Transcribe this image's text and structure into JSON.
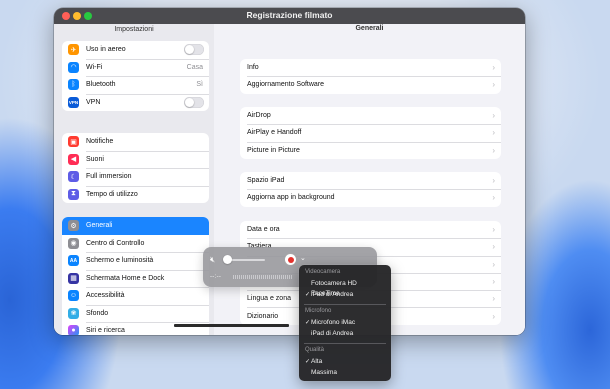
{
  "window": {
    "title": "Registrazione filmato",
    "sidebar_title": "Impostazioni",
    "main_title": "Generali"
  },
  "sidebar": {
    "group1": [
      {
        "label": "Uso in aereo",
        "icon": "airplane-icon",
        "color": "#ff9500",
        "control": "toggle"
      },
      {
        "label": "Wi-Fi",
        "icon": "wifi-icon",
        "color": "#0a84ff",
        "value": "Casa"
      },
      {
        "label": "Bluetooth",
        "icon": "bluetooth-icon",
        "color": "#0a84ff",
        "value": "Sì"
      },
      {
        "label": "VPN",
        "icon": "vpn-icon",
        "color": "#0a5bd8",
        "control": "toggle"
      }
    ],
    "group2": [
      {
        "label": "Notifiche",
        "icon": "bell-icon",
        "color": "#ff3b30"
      },
      {
        "label": "Suoni",
        "icon": "speaker-icon",
        "color": "#ff2d55"
      },
      {
        "label": "Full immersion",
        "icon": "moon-icon",
        "color": "#5e5ce6"
      },
      {
        "label": "Tempo di utilizzo",
        "icon": "hourglass-icon",
        "color": "#5e5ce6"
      }
    ],
    "group3": [
      {
        "label": "Generali",
        "icon": "gear-icon",
        "color": "#8e8e93",
        "selected": true
      },
      {
        "label": "Centro di Controllo",
        "icon": "control-center-icon",
        "color": "#8e8e93"
      },
      {
        "label": "Schermo e luminosità",
        "icon": "brightness-icon",
        "color": "#0a84ff"
      },
      {
        "label": "Schermata Home e Dock",
        "icon": "home-screen-icon",
        "color": "#3634a3"
      },
      {
        "label": "Accessibilità",
        "icon": "accessibility-icon",
        "color": "#0a84ff"
      },
      {
        "label": "Sfondo",
        "icon": "wallpaper-icon",
        "color": "#32ade6"
      },
      {
        "label": "Siri e ricerca",
        "icon": "siri-icon",
        "color": "#222222"
      }
    ]
  },
  "main": {
    "group1": [
      "Info",
      "Aggiornamento Software"
    ],
    "group2": [
      "AirDrop",
      "AirPlay e Handoff",
      "Picture in Picture"
    ],
    "group3": [
      "Spazio iPad",
      "Aggiorna app in background"
    ],
    "group4": [
      "Data e ora",
      "Tastiera",
      "",
      "",
      "Lingua e zona",
      "Dizionario"
    ]
  },
  "recorder": {
    "timecode": "--:--"
  },
  "menu": {
    "videocamera_header": "Videocamera",
    "video_options": [
      {
        "label": "Fotocamera HD FaceTime",
        "checked": false
      },
      {
        "label": "iPad di Andrea",
        "checked": true
      }
    ],
    "microfono_header": "Microfono",
    "mic_options": [
      {
        "label": "Microfono iMac",
        "checked": true
      },
      {
        "label": "iPad di Andrea",
        "checked": false
      }
    ],
    "qualita_header": "Qualità",
    "quality_options": [
      {
        "label": "Alta",
        "checked": true
      },
      {
        "label": "Massima",
        "checked": false
      }
    ],
    "check_glyph": "✓"
  }
}
